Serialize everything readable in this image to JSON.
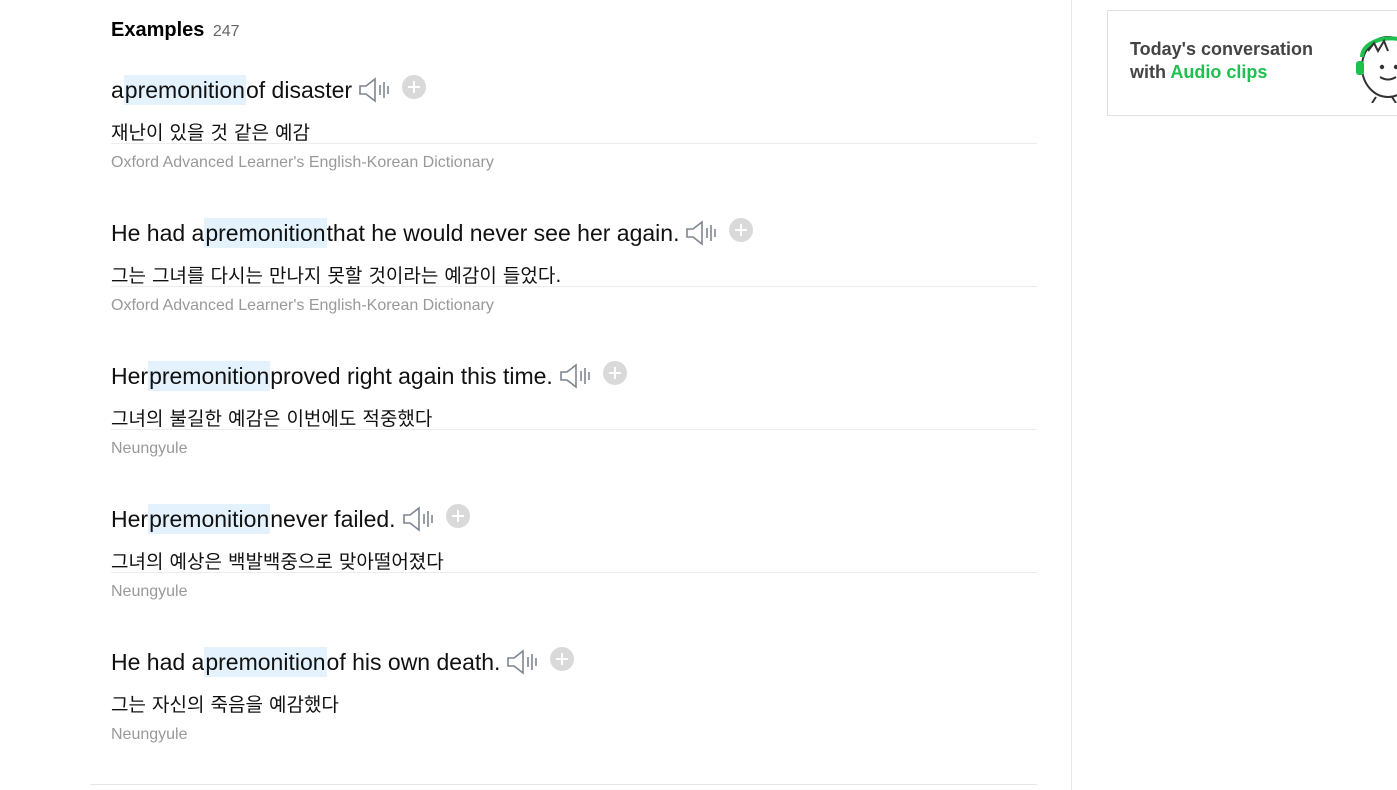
{
  "examples": {
    "title": "Examples",
    "count": "247",
    "items": [
      {
        "pre": "a ",
        "highlight": "premonition",
        "post": " of disaster",
        "translation": "재난이 있을 것 같은 예감",
        "source": "Oxford Advanced Learner's English-Korean Dictionary"
      },
      {
        "pre": "He had a ",
        "highlight": "premonition",
        "post": " that he would never see her again.",
        "translation": "그는 그녀를 다시는 만나지 못할 것이라는 예감이 들었다.",
        "source": "Oxford Advanced Learner's English-Korean Dictionary"
      },
      {
        "pre": "Her ",
        "highlight": "premonition",
        "post": " proved right again this time.",
        "translation": "그녀의 불길한 예감은 이번에도 적중했다",
        "source": "Neungyule"
      },
      {
        "pre": "Her ",
        "highlight": "premonition",
        "post": " never failed.",
        "translation": "그녀의 예상은 백발백중으로 맞아떨어졌다",
        "source": "Neungyule"
      },
      {
        "pre": "He had a ",
        "highlight": "premonition",
        "post": " of his own death.",
        "translation": "그는 자신의 죽음을 예감했다",
        "source": "Neungyule"
      }
    ]
  },
  "promo": {
    "line1": "Today's conversation",
    "line2_prefix": "with ",
    "line2_accent": "Audio clips",
    "accent_color": "#1ec04e",
    "icon": "headphones-character-icon"
  },
  "icons": {
    "speaker": "speaker-icon",
    "add": "add-circle-icon"
  },
  "colors": {
    "highlight": "#e3f2fd",
    "source_text": "#999999"
  }
}
